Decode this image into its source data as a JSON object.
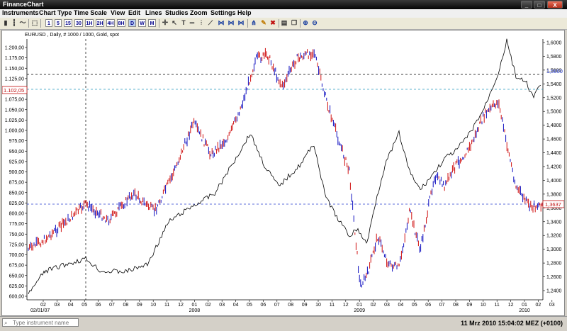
{
  "app": {
    "title": "FinanceChart"
  },
  "window_buttons": {
    "minimize": "_",
    "maximize": "□",
    "close": "X"
  },
  "menu": [
    "Instruments",
    "Chart Type",
    "Time Scale",
    "View",
    "Edit",
    "Lines",
    "Studies",
    "Zoom",
    "Settings",
    "Help"
  ],
  "toolbar": {
    "timeframes": [
      "1",
      "5",
      "15",
      "30",
      "1H",
      "2H",
      "4H",
      "8H",
      "D",
      "W",
      "M"
    ],
    "selected_timeframe": "D"
  },
  "chart": {
    "instrument_label": "EURUSD , Daily, # 1000 / 1000, Gold, spot",
    "left_axis_labels": [
      "1.200,00",
      "1.175,00",
      "1.150,00",
      "1.125,00",
      "1.100,00",
      "1.075,00",
      "1.050,00",
      "1.025,00",
      "1.000,00",
      "975,00",
      "950,00",
      "925,00",
      "900,00",
      "875,00",
      "850,00",
      "825,00",
      "800,00",
      "775,00",
      "750,00",
      "725,00",
      "700,00",
      "675,00",
      "650,00",
      "625,00",
      "600,00"
    ],
    "right_axis_labels": [
      "1,6000",
      "1,5800",
      "1,5600",
      "1,5400",
      "1,5200",
      "1,5000",
      "1,4800",
      "1,4600",
      "1,4400",
      "1,4200",
      "1,4000",
      "1,3800",
      "1,3600",
      "1,3400",
      "1,3200",
      "1,3000",
      "1,2800",
      "1,2600",
      "1,2400"
    ],
    "left_marker": "1.102,05",
    "right_marker_1": "1,5600",
    "right_marker_2": "1,3637",
    "x_month_labels": [
      "02",
      "03",
      "04",
      "05",
      "06",
      "07",
      "08",
      "09",
      "10",
      "11",
      "12",
      "01",
      "02",
      "03",
      "04",
      "05",
      "06",
      "07",
      "08",
      "09",
      "10",
      "11",
      "12",
      "01",
      "02",
      "03",
      "04",
      "05",
      "06",
      "07",
      "08",
      "09",
      "10",
      "11",
      "12",
      "01",
      "02",
      "03"
    ],
    "x_start_date": "02/01/07",
    "year_labels": [
      "2008",
      "2009",
      "2010"
    ],
    "colors": {
      "up": "#1010c0",
      "down": "#d01010",
      "line": "#000000",
      "hline_blue": "#2a3fd0",
      "hline_teal": "#2a9ac0"
    }
  },
  "status": {
    "search_placeholder": "Type instrument name",
    "datetime": "11 Mrz 2010 15:04:02  MEZ (+0100)"
  }
}
